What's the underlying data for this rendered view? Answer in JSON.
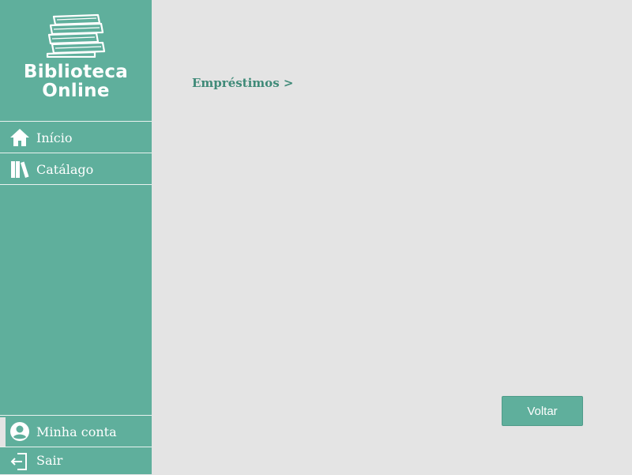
{
  "app": {
    "title_line1": "Biblioteca",
    "title_line2": "Online",
    "logo_icon": "books-stack-icon"
  },
  "sidebar": {
    "items": [
      {
        "label": "Início",
        "icon": "home-icon"
      },
      {
        "label": "Catálago",
        "icon": "books-icon"
      }
    ],
    "bottom_items": [
      {
        "label": "Minha conta",
        "icon": "user-circle-icon",
        "active": true
      },
      {
        "label": "Sair",
        "icon": "logout-icon"
      }
    ]
  },
  "main": {
    "breadcrumb": "Empréstimos >",
    "back_button": "Voltar"
  },
  "colors": {
    "sidebar": "#5faf9c",
    "background": "#e4e4e4",
    "accent_text": "#3f8a78"
  }
}
